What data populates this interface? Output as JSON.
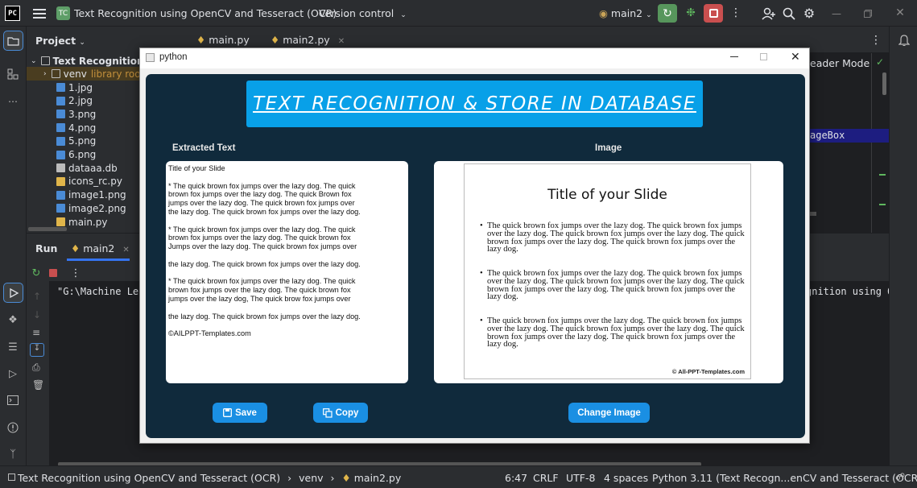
{
  "topbar": {
    "project_badge": "TC",
    "project_name": "Text Recognition using OpenCV and Tesseract (OCR)",
    "vcs": "Version control",
    "branch": "main2"
  },
  "project_panel": {
    "title": "Project",
    "root": "Text Recognition us",
    "venv": "venv",
    "venv_note": "library root",
    "files": [
      "1.jpg",
      "2.jpg",
      "3.png",
      "4.png",
      "5.png",
      "6.png",
      "dataaa.db",
      "icons_rc.py",
      "image1.png",
      "image2.png",
      "main.py"
    ]
  },
  "editor": {
    "tabs": [
      "main.py",
      "main2.py"
    ],
    "reader_mode": "eader Mode",
    "code_fragment": "ageBox"
  },
  "run": {
    "label": "Run",
    "tab": "main2",
    "console_left": "\"G:\\Machine Lea",
    "console_right": "gnition using O"
  },
  "status": {
    "breadcrumb": [
      "Text Recognition using OpenCV and Tesseract (OCR)",
      "venv",
      "main2.py"
    ],
    "position": "6:47",
    "line_sep": "CRLF",
    "encoding": "UTF-8",
    "indent": "4 spaces",
    "interpreter": "Python 3.11 (Text Recogn...enCV and Tesseract (OCR))"
  },
  "pywin": {
    "title": "python",
    "banner": "TEXT RECOGNITION & STORE IN DATABASE",
    "extracted_label": "Extracted Text",
    "image_label": "Image",
    "extracted_text": [
      "Title of your Slide",
      "* The quick brown fox jumps over the lazy dog. The quick\nbrown fox jumps over the lazy dog. The quick Brown fox\njumps over the lazy dog. The quick brown fox jumps over\nthe lazy dog. The quick brown fox jumps over the lazy dog.",
      "* The quick brown fox jumps over the lazy dog. The quick\nbrown fox jumps over the lazy dog. The quick brown fox\nJumps over the lazy dog. The quick brown fox jumps over",
      "the lazy dog. The quick brown fox jumps over the lazy dog.",
      "* The quick brown fox jumps over the lazy dog. The quick\nbrown fox jumps over the lazy dog. The quick brown fox\njumps over the lazy dog, The quick brow fox jumps over",
      "the lazy dog. The quick brown fox jumps over the lazy dog.",
      "©AILPPT-Templates.com"
    ],
    "slide": {
      "title": "Title of your Slide",
      "bullets": [
        "The quick brown fox jumps over the lazy dog. The quick brown fox jumps over the lazy dog. The quick brown fox jumps over the lazy dog. The quick brown fox jumps over the lazy dog. The quick brown fox jumps over the lazy dog.",
        "The quick brown fox jumps over the lazy dog. The quick brown fox jumps over the lazy dog. The quick brown fox jumps over the lazy dog. The quick brown fox jumps over the lazy dog. The quick brown fox jumps over the lazy dog.",
        "The quick brown fox jumps over the lazy dog. The quick brown fox jumps over the lazy dog. The quick brown fox jumps over the lazy dog. The quick brown fox jumps over the lazy dog. The quick brown fox jumps over the lazy dog."
      ],
      "copyright": "© All-PPT-Templates.com"
    },
    "save_label": "Save",
    "copy_label": "Copy",
    "change_label": "Change Image"
  },
  "colors": {
    "accent": "#08a0e8",
    "panel": "#102a3c",
    "button": "#1a8fe3",
    "ide_bg": "#1e1f22",
    "ide_panel": "#2b2d30"
  }
}
